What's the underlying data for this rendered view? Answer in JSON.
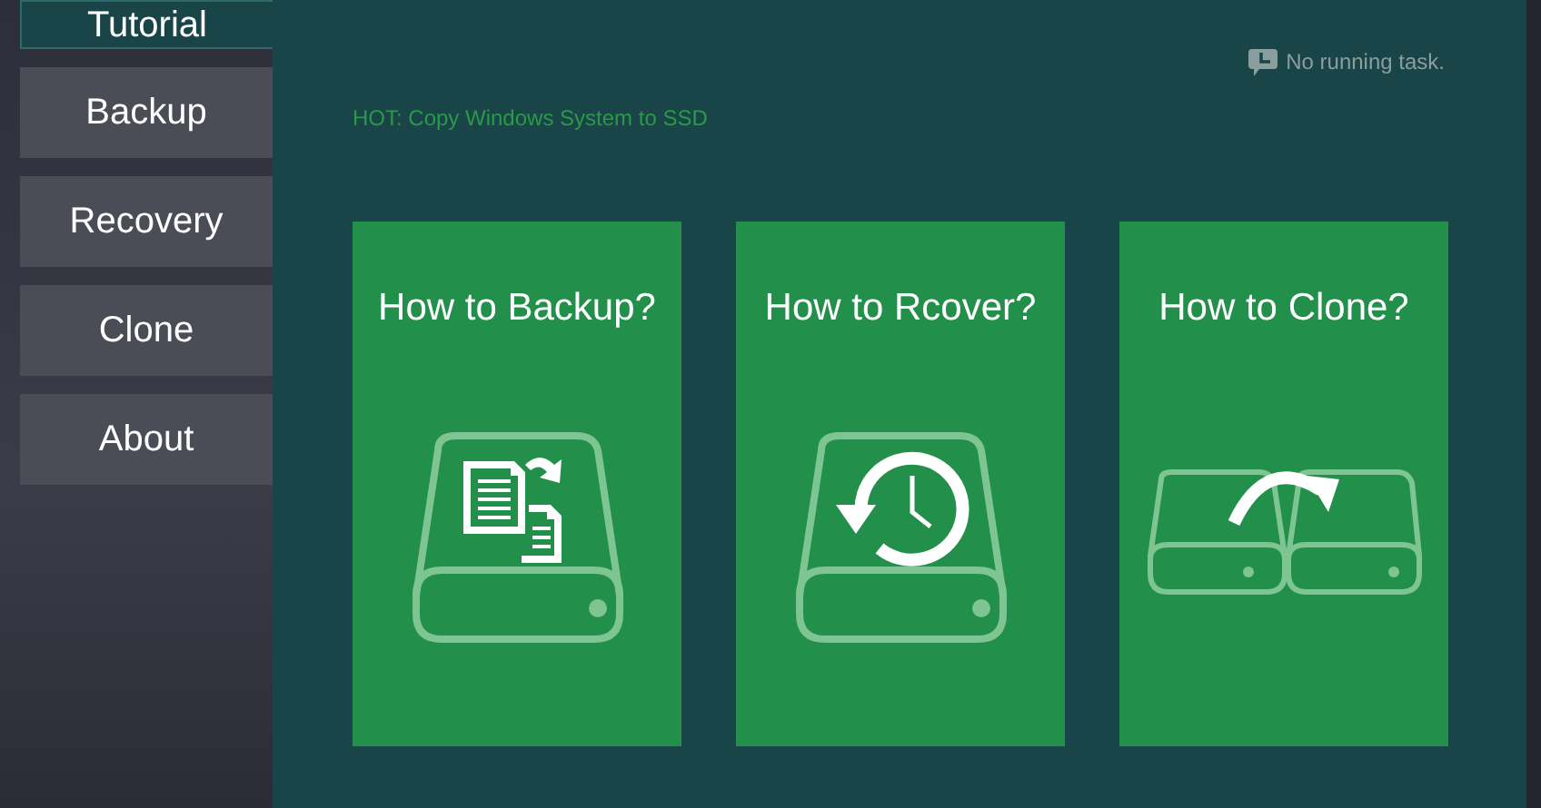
{
  "sidebar": {
    "items": [
      {
        "label": "Tutorial",
        "selected": true
      },
      {
        "label": "Backup",
        "selected": false
      },
      {
        "label": "Recovery",
        "selected": false
      },
      {
        "label": "Clone",
        "selected": false
      },
      {
        "label": "About",
        "selected": false
      }
    ]
  },
  "status": {
    "text": "No running task."
  },
  "hot_link": "HOT: Copy Windows System to SSD",
  "cards": [
    {
      "kind": "backup",
      "title": "How to Backup?"
    },
    {
      "kind": "recover",
      "title": "How to Rcover?"
    },
    {
      "kind": "clone",
      "title": "How to Clone?"
    }
  ]
}
